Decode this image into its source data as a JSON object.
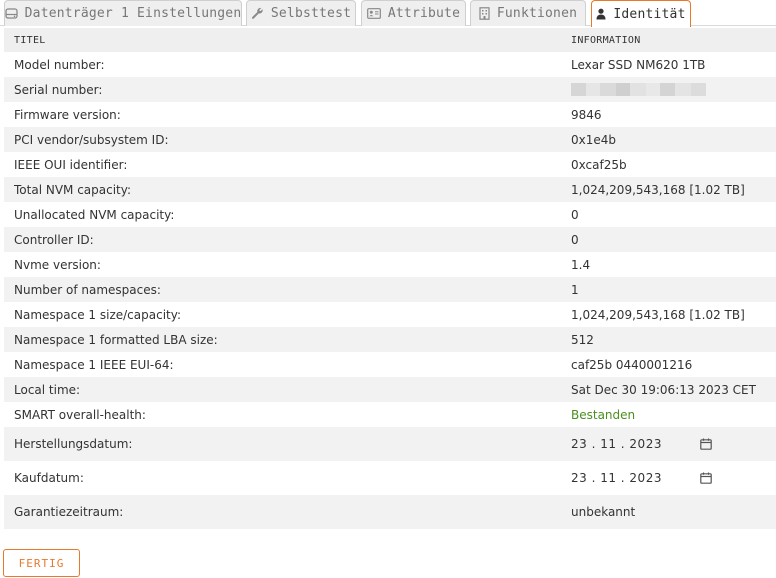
{
  "tabs": [
    {
      "label": "Datenträger 1 Einstellungen",
      "icon": "disk-icon"
    },
    {
      "label": "Selbsttest",
      "icon": "wrench-icon"
    },
    {
      "label": "Attribute",
      "icon": "id-card-icon"
    },
    {
      "label": "Funktionen",
      "icon": "building-icon"
    },
    {
      "label": "Identität",
      "icon": "user-icon",
      "active": true
    }
  ],
  "table": {
    "headers": {
      "title": "TITEL",
      "info": "INFORMATION"
    },
    "rows": [
      {
        "title": "Model number:",
        "value": "Lexar SSD NM620 1TB"
      },
      {
        "title": "Serial number:",
        "value": ""
      },
      {
        "title": "Firmware version:",
        "value": "9846"
      },
      {
        "title": "PCI vendor/subsystem ID:",
        "value": "0x1e4b"
      },
      {
        "title": "IEEE OUI identifier:",
        "value": "0xcaf25b"
      },
      {
        "title": "Total NVM capacity:",
        "value": "1,024,209,543,168 [1.02 TB]"
      },
      {
        "title": "Unallocated NVM capacity:",
        "value": "0"
      },
      {
        "title": "Controller ID:",
        "value": "0"
      },
      {
        "title": "Nvme version:",
        "value": "1.4"
      },
      {
        "title": "Number of namespaces:",
        "value": "1"
      },
      {
        "title": "Namespace 1 size/capacity:",
        "value": "1,024,209,543,168 [1.02 TB]"
      },
      {
        "title": "Namespace 1 formatted LBA size:",
        "value": "512"
      },
      {
        "title": "Namespace 1 IEEE EUI-64:",
        "value": "caf25b 0440001216"
      },
      {
        "title": "Local time:",
        "value": "Sat Dec 30 19:06:13 2023 CET"
      },
      {
        "title": "SMART overall-health:",
        "value": "Bestanden"
      },
      {
        "title": "Herstellungsdatum:",
        "value": "23 . 11 . 2023"
      },
      {
        "title": "Kaufdatum:",
        "value": "23 . 11 . 2023"
      },
      {
        "title": "Garantiezeitraum:",
        "value": "unbekannt"
      }
    ]
  },
  "colors": {
    "accent": "#e8782a",
    "ok_green": "#4a8f1f"
  },
  "footer": {
    "done_label": "FERTIG"
  }
}
